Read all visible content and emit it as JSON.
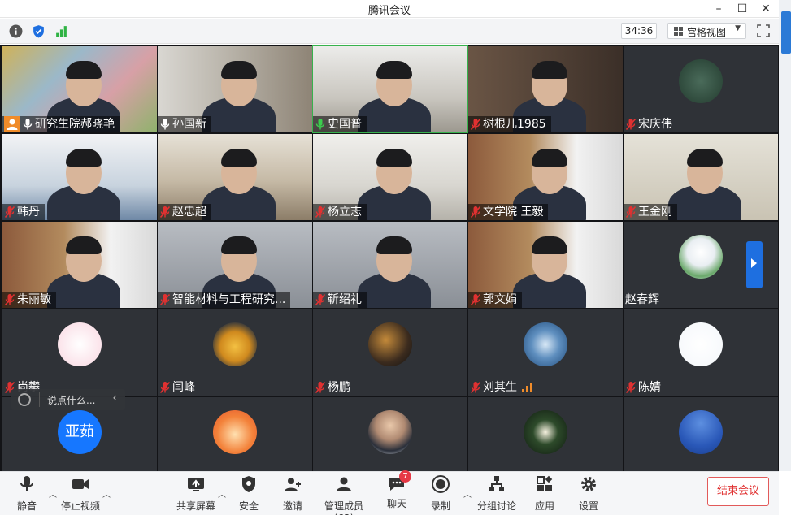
{
  "window": {
    "title": "腾讯会议",
    "minimize_icon": "minimize-icon",
    "maximize_icon": "maximize-icon",
    "close_icon": "close-icon"
  },
  "toolbar": {
    "icons": [
      "info-icon",
      "shield-icon",
      "signal-bars-icon"
    ],
    "timer": "34:36",
    "view_label": "宫格视图",
    "fullscreen_icon": "fullscreen-icon"
  },
  "participants": [
    {
      "name": "研究生院郝晓艳",
      "host": true,
      "mic": "on",
      "type": "video"
    },
    {
      "name": "孙国新",
      "mic": "on",
      "type": "video"
    },
    {
      "name": "史国普",
      "mic": "on-green",
      "type": "video",
      "active": true
    },
    {
      "name": "树根儿1985",
      "mic": "muted",
      "type": "video"
    },
    {
      "name": "宋庆伟",
      "mic": "muted",
      "type": "avatar"
    },
    {
      "name": "韩丹",
      "mic": "muted",
      "type": "video"
    },
    {
      "name": "赵忠超",
      "mic": "muted",
      "type": "video"
    },
    {
      "name": "杨立志",
      "mic": "muted",
      "type": "video"
    },
    {
      "name": "文学院 王毅",
      "mic": "muted",
      "type": "video"
    },
    {
      "name": "王金刚",
      "mic": "muted",
      "type": "video"
    },
    {
      "name": "朱丽敏",
      "mic": "muted",
      "type": "video"
    },
    {
      "name": "智能材料与工程研究...",
      "mic": "muted",
      "type": "video"
    },
    {
      "name": "靳绍礼",
      "mic": "muted",
      "type": "video"
    },
    {
      "name": "郭文娟",
      "mic": "muted",
      "type": "video"
    },
    {
      "name": "赵春辉",
      "mic": "none",
      "type": "avatar"
    },
    {
      "name": "尚攀",
      "mic": "muted",
      "type": "avatar"
    },
    {
      "name": "闫峰",
      "mic": "muted",
      "type": "avatar"
    },
    {
      "name": "杨鹏",
      "mic": "muted",
      "type": "avatar"
    },
    {
      "name": "刘其生",
      "mic": "muted",
      "type": "avatar",
      "signal": true
    },
    {
      "name": "陈婧",
      "mic": "muted",
      "type": "avatar"
    },
    {
      "name": "",
      "type": "avatar",
      "avatar_text": "亚茹"
    },
    {
      "name": "",
      "type": "avatar"
    },
    {
      "name": "",
      "type": "avatar"
    },
    {
      "name": "",
      "type": "avatar"
    },
    {
      "name": "",
      "type": "avatar"
    }
  ],
  "chat_popup": {
    "placeholder": "说点什么...",
    "emoji_icon": "smile-icon",
    "collapse_icon": "chevron-left-icon"
  },
  "bottom_bar": {
    "mute": "静音",
    "stop_video": "停止视频",
    "share_screen": "共享屏幕",
    "security": "安全",
    "invite": "邀请",
    "members": "管理成员(63)",
    "chat": "聊天",
    "chat_badge": "7",
    "record": "录制",
    "breakout": "分组讨论",
    "apps": "应用",
    "settings": "设置",
    "end_meeting": "结束会议"
  },
  "colors": {
    "accent": "#1e6fe0",
    "danger": "#e03131",
    "muted_mic": "#e03131",
    "active_border": "#37b24d",
    "host_badge": "#f08c2a"
  }
}
